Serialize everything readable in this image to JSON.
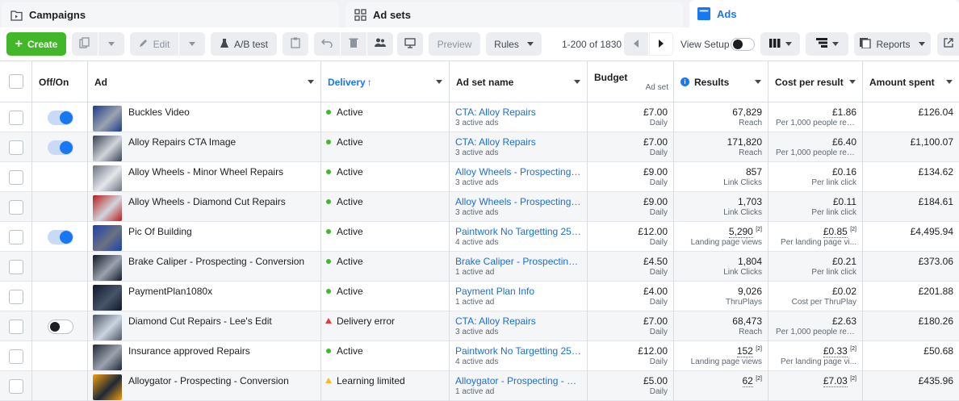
{
  "tabs": [
    {
      "label": "Campaigns",
      "icon": "folder-icon"
    },
    {
      "label": "Ad sets",
      "icon": "grid-icon"
    },
    {
      "label": "Ads",
      "icon": "ads-icon"
    }
  ],
  "toolbar": {
    "create_label": "Create",
    "edit_label": "Edit",
    "ab_test_label": "A/B test",
    "preview_label": "Preview",
    "rules_label": "Rules",
    "pagination": "1-200 of 1830",
    "view_setup_label": "View Setup",
    "reports_label": "Reports"
  },
  "columns": {
    "offon": "Off/On",
    "ad": "Ad",
    "delivery": "Delivery",
    "delivery_sort": "↑",
    "adset": "Ad set name",
    "budget": "Budget",
    "budget_sub": "Ad set",
    "results": "Results",
    "cpr": "Cost per result",
    "amount": "Amount spent"
  },
  "rows": [
    {
      "toggle": "on",
      "ad": "Buckles Video",
      "status": "Active",
      "status_type": "active",
      "adset": "CTA: Alloy Repairs",
      "adset_sub": "3 active ads",
      "budget": "£7.00",
      "budget_sub": "Daily",
      "results": "67,829",
      "results_note": "",
      "results_sub": "Reach",
      "cpr": "£1.86",
      "cpr_note": "",
      "cpr_sub": "Per 1,000 people reac...",
      "amount": "£126.04"
    },
    {
      "toggle": "on",
      "ad": "Alloy Repairs CTA Image",
      "status": "Active",
      "status_type": "active",
      "adset": "CTA: Alloy Repairs",
      "adset_sub": "3 active ads",
      "budget": "£7.00",
      "budget_sub": "Daily",
      "results": "171,820",
      "results_note": "",
      "results_sub": "Reach",
      "cpr": "£6.40",
      "cpr_note": "",
      "cpr_sub": "Per 1,000 people reac...",
      "amount": "£1,100.07"
    },
    {
      "toggle": "none",
      "ad": "Alloy Wheels - Minor Wheel Repairs",
      "status": "Active",
      "status_type": "active",
      "adset": "Alloy Wheels - Prospecting - C...",
      "adset_sub": "3 active ads",
      "budget": "£9.00",
      "budget_sub": "Daily",
      "results": "857",
      "results_note": "",
      "results_sub": "Link Clicks",
      "cpr": "£0.16",
      "cpr_note": "",
      "cpr_sub": "Per link click",
      "amount": "£134.62"
    },
    {
      "toggle": "none",
      "ad": "Alloy Wheels - Diamond Cut Repairs",
      "status": "Active",
      "status_type": "active",
      "adset": "Alloy Wheels - Prospecting - C...",
      "adset_sub": "3 active ads",
      "budget": "£9.00",
      "budget_sub": "Daily",
      "results": "1,703",
      "results_note": "",
      "results_sub": "Link Clicks",
      "cpr": "£0.11",
      "cpr_note": "",
      "cpr_sub": "Per link click",
      "amount": "£184.61"
    },
    {
      "toggle": "on",
      "ad": "Pic Of Building",
      "status": "Active",
      "status_type": "active",
      "adset": "Paintwork No Targetting 25+ ...",
      "adset_sub": "4 active ads",
      "budget": "£12.00",
      "budget_sub": "Daily",
      "results": "5,290",
      "results_note": "[2]",
      "results_sub": "Landing page views",
      "cpr": "£0.85",
      "cpr_note": "[2]",
      "cpr_sub": "Per landing page vi...",
      "amount": "£4,495.94"
    },
    {
      "toggle": "none",
      "ad": "Brake Caliper - Prospecting - Conversion",
      "status": "Active",
      "status_type": "active",
      "adset": "Brake Caliper - Prospecting - ...",
      "adset_sub": "1 active ad",
      "budget": "£4.50",
      "budget_sub": "Daily",
      "results": "1,804",
      "results_note": "",
      "results_sub": "Link Clicks",
      "cpr": "£0.21",
      "cpr_note": "",
      "cpr_sub": "Per link click",
      "amount": "£373.06"
    },
    {
      "toggle": "none",
      "ad": "PaymentPlan1080x",
      "status": "Active",
      "status_type": "active",
      "adset": "Payment Plan Info",
      "adset_sub": "1 active ad",
      "budget": "£4.00",
      "budget_sub": "Daily",
      "results": "9,026",
      "results_note": "",
      "results_sub": "ThruPlays",
      "cpr": "£0.02",
      "cpr_note": "",
      "cpr_sub": "Cost per ThruPlay",
      "amount": "£201.88"
    },
    {
      "toggle": "off",
      "ad": "Diamond Cut Repairs - Lee's Edit",
      "status": "Delivery error",
      "status_type": "error",
      "adset": "CTA: Alloy Repairs",
      "adset_sub": "3 active ads",
      "budget": "£7.00",
      "budget_sub": "Daily",
      "results": "68,473",
      "results_note": "",
      "results_sub": "Reach",
      "cpr": "£2.63",
      "cpr_note": "",
      "cpr_sub": "Per 1,000 people reac...",
      "amount": "£180.26"
    },
    {
      "toggle": "none",
      "ad": "Insurance approved Repairs",
      "status": "Active",
      "status_type": "active",
      "adset": "Paintwork No Targetting 25+ ...",
      "adset_sub": "4 active ads",
      "budget": "£12.00",
      "budget_sub": "Daily",
      "results": "152",
      "results_note": "[2]",
      "results_sub": "Landing page views",
      "cpr": "£0.33",
      "cpr_note": "[2]",
      "cpr_sub": "Per landing page vi...",
      "amount": "£50.68"
    },
    {
      "toggle": "none",
      "ad": "Alloygator - Prospecting - Conversion",
      "status": "Learning limited",
      "status_type": "warning",
      "adset": "Alloygator - Prospecting - Con...",
      "adset_sub": "1 active ad",
      "budget": "£5.00",
      "budget_sub": "Daily",
      "results": "62",
      "results_note": "[2]",
      "results_sub": "",
      "cpr": "£7.03",
      "cpr_note": "[2]",
      "cpr_sub": "",
      "amount": "£435.96"
    }
  ],
  "colors": {
    "accent": "#1877f2",
    "create": "#42b72a",
    "active": "#42b72a",
    "error": "#e4393c",
    "warning": "#f7b928",
    "link": "#1a6ed8"
  }
}
